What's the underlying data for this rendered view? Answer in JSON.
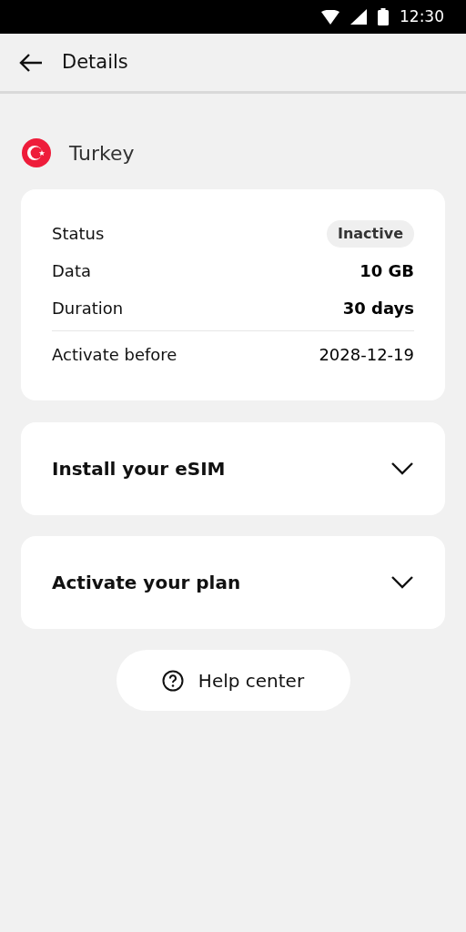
{
  "status_bar": {
    "time": "12:30"
  },
  "header": {
    "title": "Details"
  },
  "country": {
    "name": "Turkey"
  },
  "plan": {
    "rows": [
      {
        "label": "Status",
        "value": "Inactive",
        "kind": "badge"
      },
      {
        "label": "Data",
        "value": "10 GB",
        "kind": "bold"
      },
      {
        "label": "Duration",
        "value": "30 days",
        "kind": "bold"
      }
    ],
    "footer_row": {
      "label": "Activate before",
      "value": "2028-12-19"
    }
  },
  "sections": [
    {
      "title": "Install your eSIM",
      "expanded": false
    },
    {
      "title": "Activate your plan",
      "expanded": false
    }
  ],
  "help_button": {
    "label": "Help center"
  }
}
